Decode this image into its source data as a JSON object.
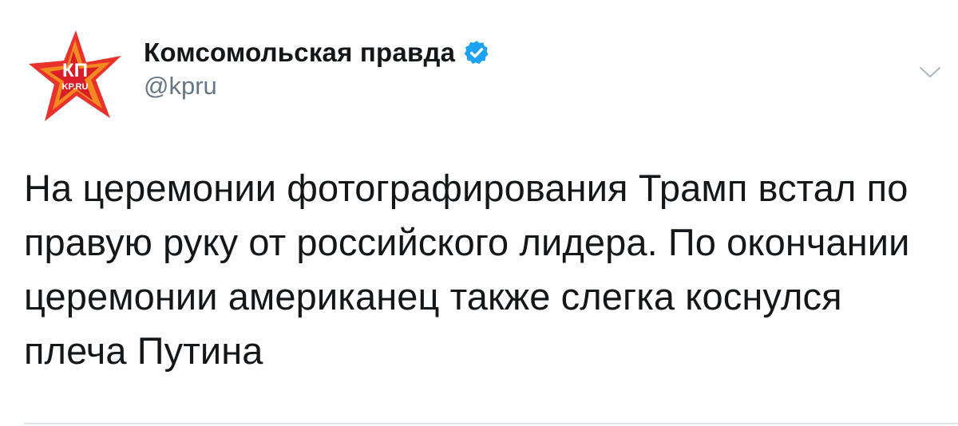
{
  "tweet": {
    "author": {
      "display_name": "Комсомольская правда",
      "handle": "@kpru",
      "verified": true,
      "avatar": {
        "icon": "kp-logo-icon",
        "logo_text_top": "КП",
        "logo_text_bottom": "KP.RU"
      }
    },
    "menu_icon": "chevron-down-icon",
    "text": "На церемонии фотографирования Трамп встал по правую руку от российского лидера. По окончании церемонии американец также слегка коснулся плеча Путина",
    "colors": {
      "text": "#14171a",
      "secondary": "#657786",
      "verified_badge": "#1da1f2",
      "divider": "#e1e8ed",
      "logo_red": "#e8322b",
      "logo_orange": "#f39a1e"
    }
  }
}
